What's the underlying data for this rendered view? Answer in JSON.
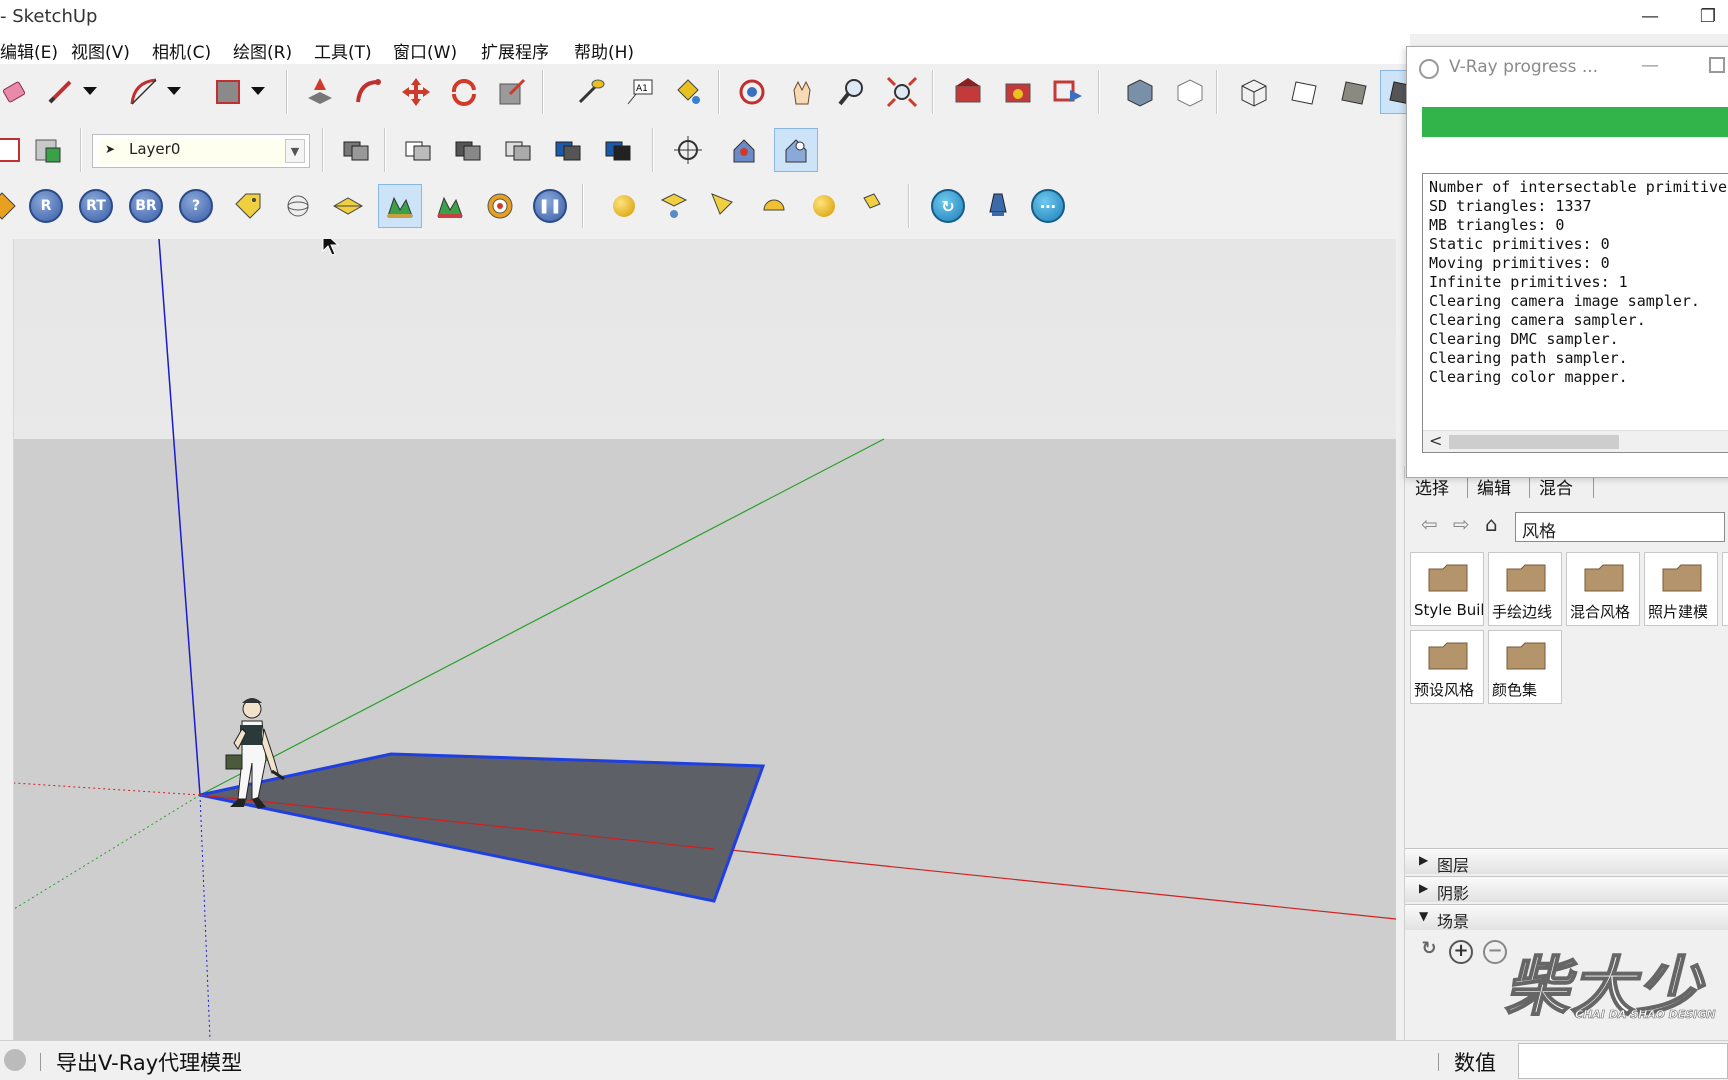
{
  "window": {
    "title": "- SketchUp",
    "minimize_label": "—",
    "restore_label": "❐"
  },
  "menu": {
    "items": [
      "编辑(E)",
      "视图(V)",
      "相机(C)",
      "绘图(R)",
      "工具(T)",
      "窗口(W)",
      "扩展程序",
      "帮助(H)"
    ]
  },
  "toolbar": {
    "layer_value": "Layer0",
    "vray_buttons": [
      "R",
      "RT",
      "BR",
      "?"
    ]
  },
  "vray_progress": {
    "title": "V-Ray progress ...",
    "progress_fraction": 1.0,
    "progress_color": "#32b44a",
    "log_lines": [
      "Number of intersectable primitives",
      "SD triangles: 1337",
      "MB triangles: 0",
      "Static primitives: 0",
      "Moving primitives: 0",
      "Infinite primitives: 1",
      "Clearing camera image sampler.",
      "Clearing camera sampler.",
      "Clearing DMC sampler.",
      "Clearing path sampler.",
      "Clearing color mapper."
    ],
    "scroll_left": "<"
  },
  "styles_panel": {
    "tabs": [
      "选择",
      "编辑",
      "混合"
    ],
    "collection_value": "风格",
    "folders": [
      "Style Buil",
      "手绘边线",
      "混合风格",
      "照片建模",
      "预设风格",
      "颜色集"
    ]
  },
  "tray_panels": {
    "layers": "图层",
    "shadows": "阴影",
    "scenes": "场景"
  },
  "watermark": {
    "text": "柴大少",
    "sub": "CHAI DA SHAO DESIGN"
  },
  "status": {
    "message": "导出V-Ray代理模型",
    "value_label": "数值",
    "value_input": ""
  },
  "colors": {
    "axis_red": "#d02020",
    "axis_green": "#2aa02a",
    "axis_blue": "#1a1ad0",
    "face": "#5e6068",
    "selection": "#1f3fe0"
  }
}
